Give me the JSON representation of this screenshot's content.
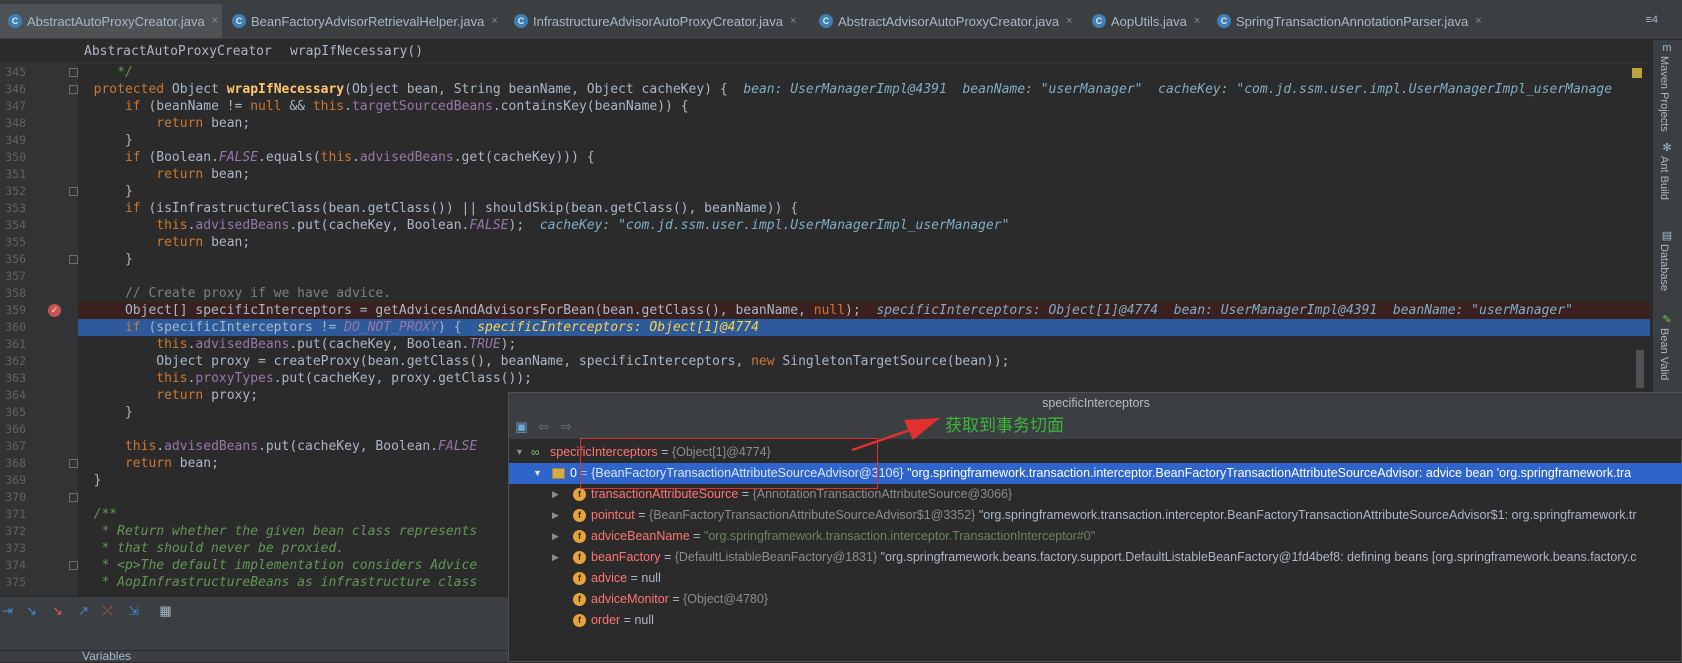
{
  "tabs": [
    {
      "name": "AbstractAutoProxyCreator.java",
      "active": true
    },
    {
      "name": "BeanFactoryAdvisorRetrievalHelper.java",
      "active": false
    },
    {
      "name": "InfrastructureAdvisorAutoProxyCreator.java",
      "active": false
    },
    {
      "name": "AbstractAdvisorAutoProxyCreator.java",
      "active": false
    },
    {
      "name": "AopUtils.java",
      "active": false
    },
    {
      "name": "SpringTransactionAnnotationParser.java",
      "active": false
    }
  ],
  "tabs_more": "≡4",
  "breadcrumb": {
    "class_name": "AbstractAutoProxyCreator",
    "method_name": "wrapIfNecessary()"
  },
  "line_numbers": [
    "345",
    "346",
    "347",
    "348",
    "349",
    "350",
    "351",
    "352",
    "353",
    "354",
    "355",
    "356",
    "357",
    "358",
    "359",
    "360",
    "361",
    "362",
    "363",
    "364",
    "365",
    "366",
    "367",
    "368",
    "369",
    "370",
    "371",
    "372",
    "373",
    "374",
    "375"
  ],
  "code": {
    "l345": " */",
    "l346_a": "protected",
    "l346_b": " Object ",
    "l346_c": "wrapIfNecessary",
    "l346_d": "(Object bean, String beanName, Object cacheKey) {",
    "l346_hint": "bean: UserManagerImpl@4391  beanName: \"userManager\"  cacheKey: \"com.jd.ssm.user.impl.UserManagerImpl_userManage",
    "l347_a": "if",
    "l347_b": " (beanName != ",
    "l347_c": "null",
    "l347_d": " && ",
    "l347_e": "this",
    "l347_f": ".",
    "l347_g": "targetSourcedBeans",
    "l347_h": ".containsKey(beanName)) {",
    "l348_a": "return",
    "l348_b": " bean;",
    "l349": "}",
    "l350_a": "if",
    "l350_b": " (Boolean.",
    "l350_c": "FALSE",
    "l350_d": ".equals(",
    "l350_e": "this",
    "l350_f": ".",
    "l350_g": "advisedBeans",
    "l350_h": ".get(cacheKey))) {",
    "l351_a": "return",
    "l351_b": " bean;",
    "l352": "}",
    "l353_a": "if",
    "l353_b": " (isInfrastructureClass(bean.getClass()) || shouldSkip(bean.getClass(), beanName)) {",
    "l354_a": "this",
    "l354_b": ".",
    "l354_c": "advisedBeans",
    "l354_d": ".put(cacheKey, Boolean.",
    "l354_e": "FALSE",
    "l354_f": ");",
    "l354_hint": "cacheKey: \"com.jd.ssm.user.impl.UserManagerImpl_userManager\"",
    "l355_a": "return",
    "l355_b": " bean;",
    "l356": "}",
    "l358": "// Create proxy if we have advice.",
    "l359_a": "Object[] specificInterceptors = getAdvicesAndAdvisorsForBean(bean.getClass(), beanName, ",
    "l359_b": "null",
    "l359_c": ");",
    "l359_hint": "specificInterceptors: Object[1]@4774  bean: UserManagerImpl@4391  beanName: \"userManager\"",
    "l360_a": "if",
    "l360_b": " (specificInterceptors != ",
    "l360_c": "DO_NOT_PROXY",
    "l360_d": ") {",
    "l360_hint": "specificInterceptors: Object[1]@4774",
    "l361_a": "this",
    "l361_b": ".",
    "l361_c": "advisedBeans",
    "l361_d": ".put(cacheKey, Boolean.",
    "l361_e": "TRUE",
    "l361_f": ");",
    "l362_a": "Object proxy = createProxy(bean.getClass(), beanName, specificInterceptors, ",
    "l362_b": "new",
    "l362_c": " SingletonTargetSource(bean));",
    "l363_a": "this",
    "l363_b": ".",
    "l363_c": "proxyTypes",
    "l363_d": ".put(cacheKey, proxy.getClass());",
    "l364_a": "return",
    "l364_b": " proxy;",
    "l365": "}",
    "l367_a": "this",
    "l367_b": ".",
    "l367_c": "advisedBeans",
    "l367_d": ".put(cacheKey, Boolean.",
    "l367_e": "FALSE",
    "l368_a": "return",
    "l368_b": " bean;",
    "l369": "}",
    "l371": "/**",
    "l372": " * Return whether the given bean class represents",
    "l373": " * that should never be proxied.",
    "l374": " * <p>The default implementation considers Advice",
    "l375": " * AopInfrastructureBeans as infrastructure class"
  },
  "right_panel": {
    "maven": "Maven Projects",
    "ant": "Ant Build",
    "database": "Database",
    "bean": "Bean Valid"
  },
  "debug": {
    "variables_label": "Variables"
  },
  "popup": {
    "title": "specificInterceptors",
    "rows": [
      {
        "name": "specificInterceptors",
        "eq": " = ",
        "type": "{Object[1]@4774}",
        "value": ""
      },
      {
        "name": "0",
        "eq": " = ",
        "type": "{BeanFactoryTransactionAttributeSourceAdvisor@3106}",
        "value": " \"org.springframework.transaction.interceptor.BeanFactoryTransactionAttributeSourceAdvisor: advice bean 'org.springframework.tra"
      },
      {
        "name": "transactionAttributeSource",
        "eq": " = ",
        "type": "{AnnotationTransactionAttributeSource@3066}",
        "value": ""
      },
      {
        "name": "pointcut",
        "eq": " = ",
        "type": "{BeanFactoryTransactionAttributeSourceAdvisor$1@3352}",
        "value": " \"org.springframework.transaction.interceptor.BeanFactoryTransactionAttributeSourceAdvisor$1: org.springframework.tr"
      },
      {
        "name": "adviceBeanName",
        "eq": " = ",
        "type": "",
        "value": "\"org.springframework.transaction.interceptor.TransactionInterceptor#0\""
      },
      {
        "name": "beanFactory",
        "eq": " = ",
        "type": "{DefaultListableBeanFactory@1831}",
        "value": " \"org.springframework.beans.factory.support.DefaultListableBeanFactory@1fd4bef8: defining beans [org.springframework.beans.factory.c"
      },
      {
        "name": "advice",
        "eq": " = ",
        "type": "",
        "value": "null"
      },
      {
        "name": "adviceMonitor",
        "eq": " = ",
        "type": "{Object@4780}",
        "value": ""
      },
      {
        "name": "order",
        "eq": " = ",
        "type": "",
        "value": "null"
      }
    ]
  },
  "annotation": {
    "text": "获取到事务切面",
    "color": "#3bb73b",
    "box_color": "#e03030"
  },
  "colors": {
    "keyword": "#cc7832",
    "method": "#ffc66d",
    "field": "#9876aa",
    "javadoc": "#629755",
    "hint": "#7faec6",
    "selection": "#2f65ca",
    "current_line": "#2d5a9a"
  }
}
